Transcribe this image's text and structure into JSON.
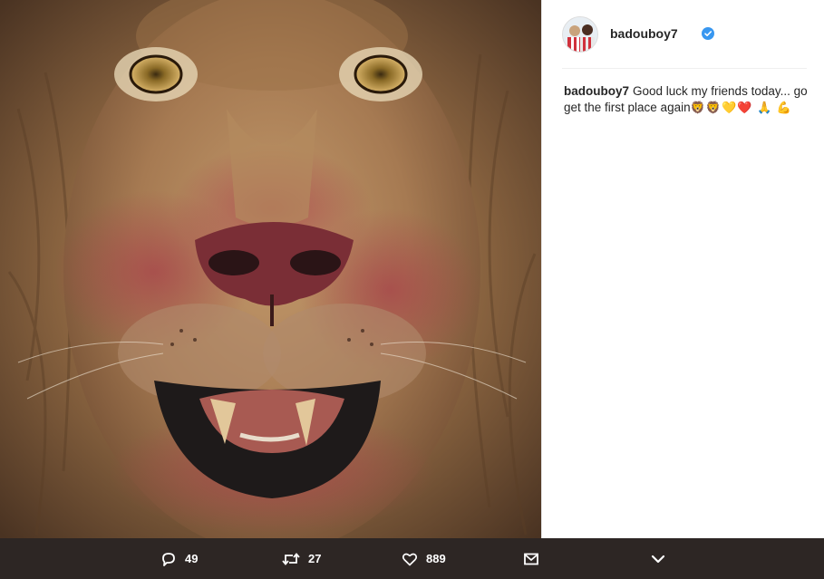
{
  "post": {
    "username": "badouboy7",
    "verified": true,
    "caption_user": "badouboy7",
    "caption_text": "Good luck my friends today... go get the first place again",
    "caption_emojis": "🦁🦁💛❤️ 🙏 💪"
  },
  "actions": {
    "reply_count": "49",
    "retweet_count": "27",
    "like_count": "889"
  },
  "icons": {
    "reply": "speech-bubble-icon",
    "retweet": "retweet-icon",
    "like": "heart-icon",
    "message": "envelope-icon",
    "more": "chevron-down-icon",
    "verified": "verified-badge-icon"
  },
  "colors": {
    "footer_bg": "#2d2624",
    "verified_blue": "#3897f0",
    "text": "#262626"
  }
}
